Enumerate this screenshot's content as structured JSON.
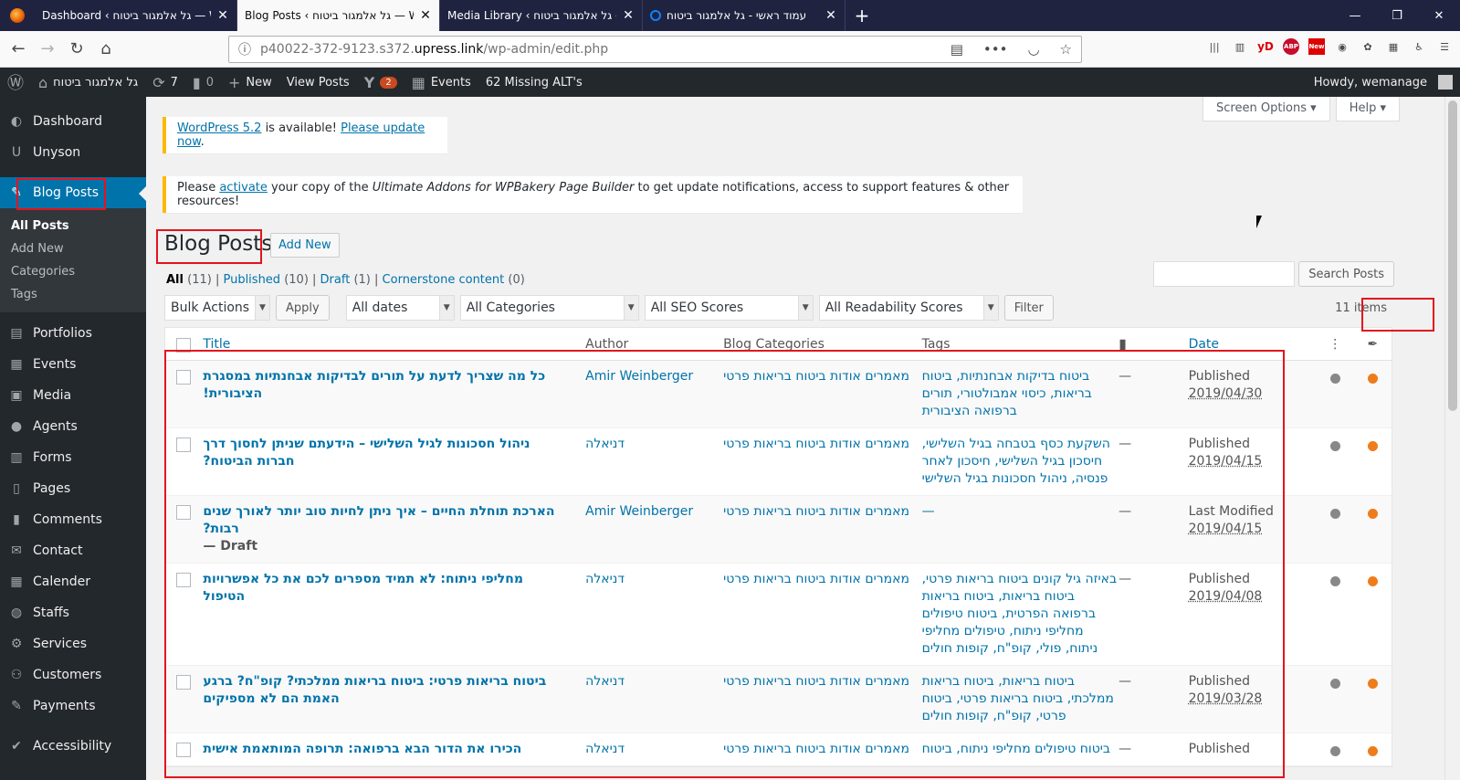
{
  "browser": {
    "tabs": [
      {
        "title": "Dashboard ‹ גל אלמגור ביטוח — Wo",
        "active": false
      },
      {
        "title": "Blog Posts ‹ גל אלמגור ביטוח — Wo",
        "active": true
      },
      {
        "title": "Media Library ‹ גל אלמגור ביטוח —",
        "active": false
      },
      {
        "title": "עמוד ראשי - גל אלמגור ביטוח",
        "active": false
      }
    ],
    "url_prefix": "p40022-372-9123.s372.",
    "url_host": "upress.link",
    "url_path": "/wp-admin/edit.php",
    "ext_yd": "yD",
    "ext_abp": "ABP",
    "ext_new": "New"
  },
  "adminbar": {
    "site_name": "גל אלמגור ביטוח",
    "updates_count": "7",
    "comments_count": "0",
    "new_label": "New",
    "view_posts": "View Posts",
    "yoast_badge": "2",
    "events": "Events",
    "missing_alt": "62 Missing ALT's",
    "howdy": "Howdy, wemanage"
  },
  "sidebar": {
    "items_top": [
      {
        "label": "Dashboard",
        "icon": "dashboard-icon"
      },
      {
        "label": "Unyson",
        "icon": "unyson-icon"
      }
    ],
    "current": {
      "label": "Blog Posts",
      "icon": "pin-icon"
    },
    "sub": [
      "All Posts",
      "Add New",
      "Categories",
      "Tags"
    ],
    "items_bottom": [
      {
        "label": "Portfolios",
        "icon": "portfolio-icon"
      },
      {
        "label": "Events",
        "icon": "calendar-icon"
      },
      {
        "label": "Media",
        "icon": "media-icon"
      },
      {
        "label": "Agents",
        "icon": "user-icon"
      },
      {
        "label": "Forms",
        "icon": "forms-icon"
      },
      {
        "label": "Pages",
        "icon": "pages-icon"
      },
      {
        "label": "Comments",
        "icon": "comments-icon"
      },
      {
        "label": "Contact",
        "icon": "mail-icon"
      },
      {
        "label": "Calender",
        "icon": "calendar-icon"
      },
      {
        "label": "Staffs",
        "icon": "staff-icon"
      },
      {
        "label": "Services",
        "icon": "services-icon"
      },
      {
        "label": "Customers",
        "icon": "customers-icon"
      },
      {
        "label": "Payments",
        "icon": "payments-icon"
      },
      {
        "label": "Accessibility",
        "icon": "check-icon"
      }
    ]
  },
  "main": {
    "screen_options": "Screen Options",
    "help": "Help",
    "notice1": {
      "link1": "WordPress 5.2",
      "mid": " is available! ",
      "link2": "Please update now",
      "end": "."
    },
    "notice2": {
      "pre": "Please ",
      "link": "activate",
      "mid": " your copy of the ",
      "em": "Ultimate Addons for WPBakery Page Builder",
      "end": " to get update notifications, access to support features & other resources!"
    },
    "title": "Blog Posts",
    "add_new": "Add New",
    "filters": [
      {
        "label": "All",
        "count": "(11)"
      },
      {
        "label": "Published",
        "count": "(10)"
      },
      {
        "label": "Draft",
        "count": "(1)"
      },
      {
        "label": "Cornerstone content",
        "count": "(0)"
      }
    ],
    "search_button": "Search Posts",
    "bulk_actions": "Bulk Actions",
    "apply": "Apply",
    "all_dates": "All dates",
    "all_categories": "All Categories",
    "all_seo": "All SEO Scores",
    "all_readability": "All Readability Scores",
    "filter": "Filter",
    "items_count": "11 items",
    "columns": {
      "title": "Title",
      "author": "Author",
      "categories": "Blog Categories",
      "tags": "Tags",
      "date": "Date"
    },
    "rows": [
      {
        "title": "כל מה שצריך לדעת על תורים לבדיקות אבחנתיות במסגרת הציבורית!",
        "state": "",
        "author": "Amir Weinberger",
        "categories": "מאמרים אודות ביטוח בריאות פרטי",
        "tags": "ביטוח בדיקות אבחנתיות, ביטוח בריאות, כיסוי אמבולטורי, תורים ברפואה הציבורית",
        "comments": "—",
        "status": "Published",
        "date": "2019/04/30",
        "seo_color": "#888888",
        "read_color": "#ee7c1b"
      },
      {
        "title": "ניהול חסכונות לגיל השלישי – הידעתם שניתן לחסוך דרך חברות הביטוח?",
        "state": "",
        "author": "דניאלה",
        "categories": "מאמרים אודות ביטוח בריאות פרטי",
        "tags": "השקעת כסף בטבחה בגיל השלישי, חיסכון בגיל השלישי, חיסכון לאחר פנסיה, ניהול חסכונות בגיל השלישי",
        "comments": "—",
        "status": "Published",
        "date": "2019/04/15",
        "seo_color": "#888888",
        "read_color": "#ee7c1b"
      },
      {
        "title": "הארכת תוחלת החיים – איך ניתן לחיות טוב יותר לאורך שנים רבות?",
        "state": "— Draft",
        "author": "Amir Weinberger",
        "categories": "מאמרים אודות ביטוח בריאות פרטי",
        "tags": "—",
        "comments": "—",
        "status": "Last Modified",
        "date": "2019/04/15",
        "seo_color": "#888888",
        "read_color": "#ee7c1b"
      },
      {
        "title": "מחליפי ניתוח: לא תמיד מספרים לכם את כל אפשרויות הטיפול",
        "state": "",
        "author": "דניאלה",
        "categories": "מאמרים אודות ביטוח בריאות פרטי",
        "tags": "באיזה גיל קונים ביטוח בריאות פרטי, ביטוח בריאות, ביטוח בריאות ברפואה הפרטית, ביטוח טיפולים מחליפי ניתוח, טיפולים מחליפי ניתוח, פולי, קופ\"ח, קופות חולים",
        "comments": "—",
        "status": "Published",
        "date": "2019/04/08",
        "seo_color": "#888888",
        "read_color": "#ee7c1b"
      },
      {
        "title": "ביטוח בריאות פרטי: ביטוח בריאות ממלכתי? קופ\"ח? ברגע האמת הם לא מספיקים",
        "state": "",
        "author": "דניאלה",
        "categories": "מאמרים אודות ביטוח בריאות פרטי",
        "tags": "ביטוח בריאות, ביטוח בריאות ממלכתי, ביטוח בריאות פרטי, ביטוח פרטי, קופ\"ח, קופות חולים",
        "comments": "—",
        "status": "Published",
        "date": "2019/03/28",
        "seo_color": "#888888",
        "read_color": "#ee7c1b"
      },
      {
        "title": "הכירו את הדור הבא ברפואה: תרופה המותאמת אישית",
        "state": "",
        "author": "דניאלה",
        "categories": "מאמרים אודות ביטוח בריאות פרטי",
        "tags": "ביטוח טיפולים מחליפי ניתוח, ביטוח",
        "comments": "—",
        "status": "Published",
        "date": "",
        "seo_color": "#888888",
        "read_color": "#ee7c1b"
      }
    ]
  }
}
